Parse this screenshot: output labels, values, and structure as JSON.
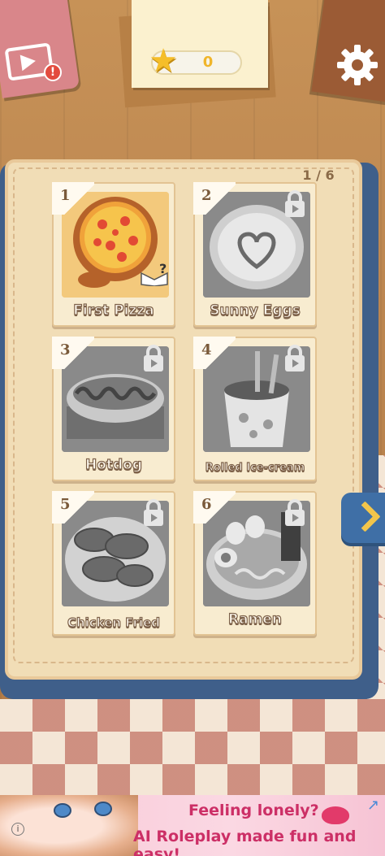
{
  "hud": {
    "star_count": "0",
    "alert_badge": "!",
    "icons": [
      "video-ad-icon",
      "star-icon",
      "gear-icon"
    ]
  },
  "book": {
    "page_indicator": "1 / 6",
    "next_icon": "chevron-right-icon",
    "recipes": [
      {
        "number": "1",
        "title": "First Pizza",
        "locked": false
      },
      {
        "number": "2",
        "title": "Sunny Eggs",
        "locked": true
      },
      {
        "number": "3",
        "title": "Hotdog",
        "locked": true
      },
      {
        "number": "4",
        "title": "Rolled Ice-cream",
        "locked": true
      },
      {
        "number": "5",
        "title": "Chicken Fried",
        "locked": true
      },
      {
        "number": "6",
        "title": "Ramen",
        "locked": true
      }
    ]
  },
  "ad": {
    "line1": "Feeling lonely?",
    "line2": "AI Roleplay made fun and easy!",
    "info": "i",
    "close": "↗"
  },
  "colors": {
    "accent_star": "#f5be2a",
    "book_blue": "#3f6fa6",
    "page_cream": "#f1ddb6"
  }
}
